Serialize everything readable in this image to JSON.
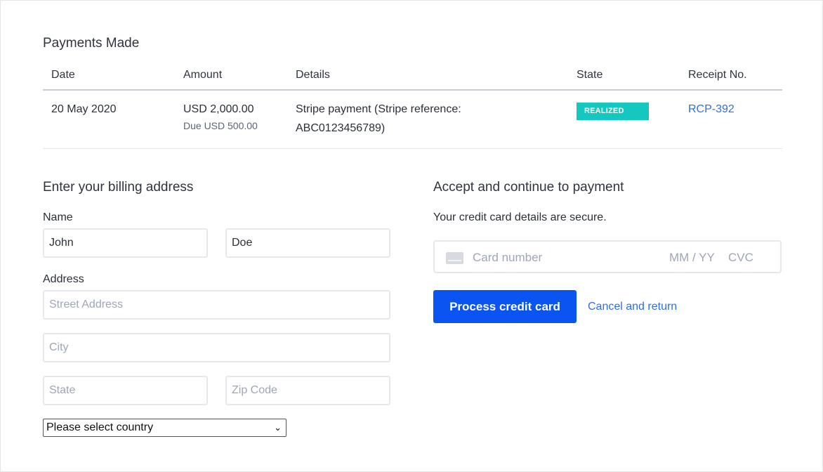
{
  "payments": {
    "title": "Payments Made",
    "columns": [
      "Date",
      "Amount",
      "Details",
      "State",
      "Receipt No."
    ],
    "rows": [
      {
        "date": "20 May 2020",
        "amount": "USD 2,000.00",
        "due": "Due USD 500.00",
        "details_line1": "Stripe payment (Stripe reference:",
        "details_line2": "ABC0123456789)",
        "state": "REALIZED",
        "receipt": "RCP-392"
      }
    ]
  },
  "billing": {
    "title": "Enter your billing address",
    "name_label": "Name",
    "first_name_value": "John",
    "last_name_value": "Doe",
    "address_label": "Address",
    "street_placeholder": "Street Address",
    "city_placeholder": "City",
    "state_placeholder": "State",
    "zip_placeholder": "Zip Code",
    "country_selected": "Please select country"
  },
  "payment": {
    "title": "Accept and continue to payment",
    "secure_text": "Your credit card details are secure.",
    "card_number_placeholder": "Card number",
    "expiry_placeholder": "MM / YY",
    "cvc_placeholder": "CVC",
    "process_button": "Process credit card",
    "cancel_link": "Cancel and return"
  },
  "colors": {
    "accent": "#0a55f2",
    "link": "#2d6fe0",
    "status_realized": "#14c8c0"
  }
}
